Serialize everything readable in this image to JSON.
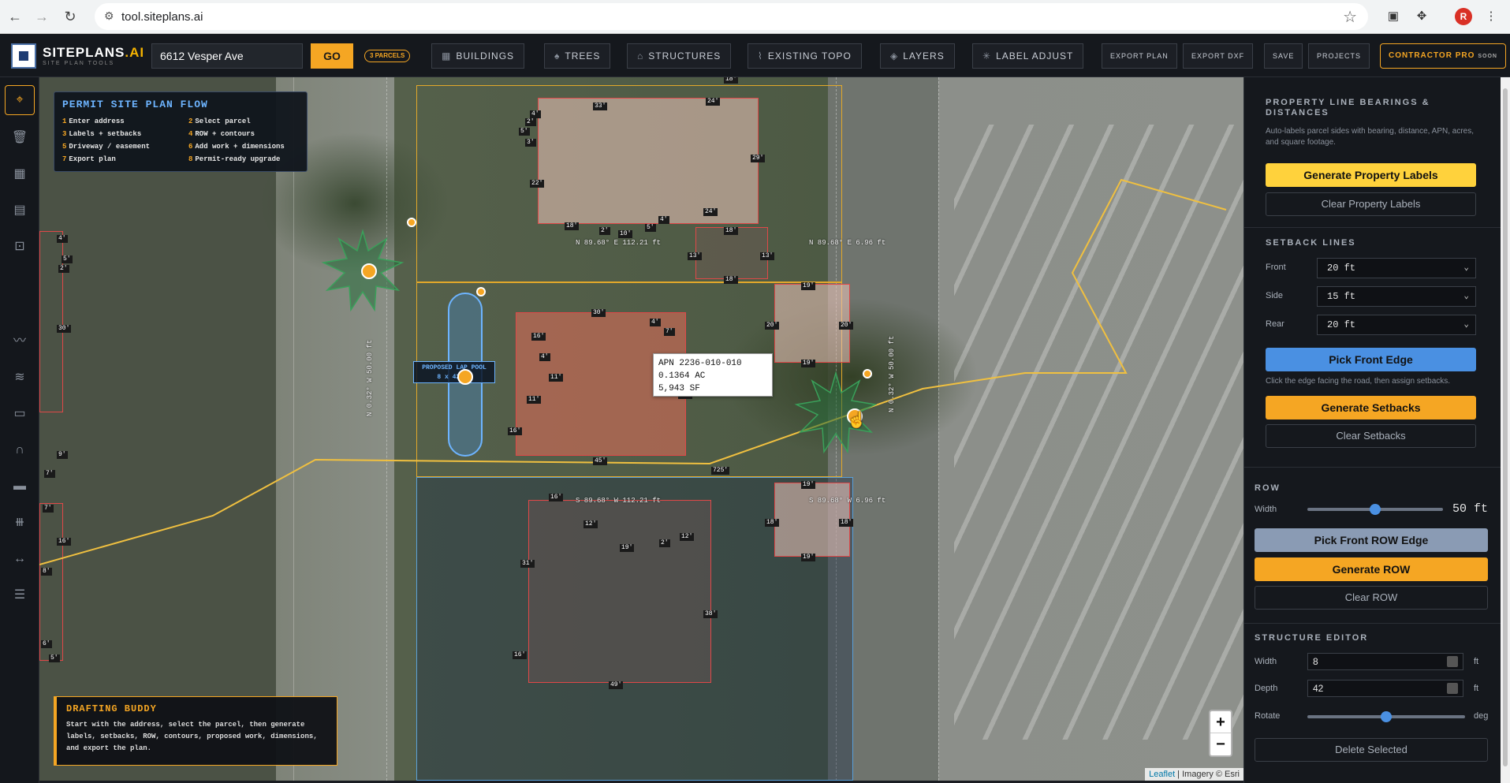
{
  "browser": {
    "url": "tool.siteplans.ai",
    "avatar_letter": "R"
  },
  "topbar": {
    "brand": "SITEPLANS",
    "brand_suffix": ".AI",
    "tagline": "SITE PLAN TOOLS",
    "address_value": "6612 Vesper Ave",
    "go_label": "GO",
    "parcels_badge": "3 PARCELS",
    "buttons": {
      "buildings": "BUILDINGS",
      "trees": "TREES",
      "structures": "STRUCTURES",
      "existing_topo": "EXISTING TOPO",
      "layers": "LAYERS",
      "label_adjust": "LABEL ADJUST",
      "export_plan": "EXPORT PLAN",
      "export_dxf": "EXPORT DXF",
      "save": "SAVE",
      "projects": "PROJECTS"
    },
    "pro_label": "CONTRACTOR PRO",
    "pro_soon": "SOON"
  },
  "map": {
    "flow": {
      "title": "PERMIT SITE PLAN FLOW",
      "steps": [
        {
          "n": "1",
          "text": "Enter address"
        },
        {
          "n": "2",
          "text": "Select parcel"
        },
        {
          "n": "3",
          "text": "Labels + setbacks"
        },
        {
          "n": "4",
          "text": "ROW + contours"
        },
        {
          "n": "5",
          "text": "Driveway / easement"
        },
        {
          "n": "6",
          "text": "Add work + dimensions"
        },
        {
          "n": "7",
          "text": "Export plan"
        },
        {
          "n": "8",
          "text": "Permit-ready upgrade"
        }
      ]
    },
    "apn": {
      "line1": "APN 2236-010-010",
      "line2": "0.1364 AC",
      "line3": "5,943 SF"
    },
    "pool": {
      "line1": "PROPOSED LAP POOL",
      "line2": "8 x 42 ft"
    },
    "bearings": {
      "b1": "N 89.68° E 112.21 ft",
      "b2": "N 89.68° E 6.96 ft",
      "b3": "S 89.68° W 112.21 ft",
      "b4": "S 89.68° W 6.96 ft",
      "b5": "N 0.32° W 50.00 ft",
      "b6": "N 0.32° W 50.00 ft"
    },
    "dims": {
      "d18a": "18'",
      "d33": "33'",
      "d24a": "24'",
      "d4a": "4'",
      "d2a": "2'",
      "d5a": "5'",
      "d3a": "3'",
      "d22": "22'",
      "d29": "29'",
      "d24b": "24'",
      "d18b": "18'",
      "d2b": "2'",
      "d10": "10'",
      "d5b": "5'",
      "d4b": "4'",
      "d18c": "18'",
      "d13a": "13'",
      "d13b": "13'",
      "d18d": "18'",
      "d19a": "19'",
      "d20a": "20'",
      "d20b": "20'",
      "d19b": "19'",
      "d30": "30'",
      "d4c": "4'",
      "d7a": "7'",
      "d16a": "16'",
      "d4d": "4'",
      "d11a": "11'",
      "d11b": "11'",
      "d16b": "16'",
      "d45": "45'",
      "d33b": "33'",
      "d725": "725'",
      "d19c": "19'",
      "d18e": "18'",
      "d18f": "18'",
      "d19d": "19'",
      "d16c": "16'",
      "d12a": "12'",
      "d19e": "19'",
      "d2c": "2'",
      "d12b": "12'",
      "d31": "31'",
      "d38": "38'",
      "d16d": "16'",
      "d49": "49'",
      "l4": "4'",
      "l5": "5'",
      "l2": "2'",
      "l30": "30'",
      "l9": "9'",
      "l7a": "7'",
      "l7b": "7'",
      "l16": "16'",
      "l8": "8'",
      "l6": "6'",
      "l5b": "5'"
    },
    "buddy": {
      "title": "DRAFTING BUDDY",
      "text": "Start with the address, select the parcel, then generate labels, setbacks, ROW, contours, proposed work, dimensions, and export the plan."
    },
    "zoom_in": "+",
    "zoom_out": "−",
    "attribution_leaflet": "Leaflet",
    "attribution_rest": " | Imagery © Esri"
  },
  "panel": {
    "property": {
      "heading": "PROPERTY LINE BEARINGS & DISTANCES",
      "note": "Auto-labels parcel sides with bearing, distance, APN, acres, and square footage.",
      "generate": "Generate Property Labels",
      "clear": "Clear Property Labels"
    },
    "setback": {
      "heading": "SETBACK LINES",
      "front_label": "Front",
      "front_value": "20 ft",
      "side_label": "Side",
      "side_value": "15 ft",
      "rear_label": "Rear",
      "rear_value": "20 ft",
      "pick": "Pick Front Edge",
      "note": "Click the edge facing the road, then assign setbacks.",
      "generate": "Generate Setbacks",
      "clear": "Clear Setbacks"
    },
    "row": {
      "heading": "ROW",
      "width_label": "Width",
      "width_value": "50 ft",
      "width_fraction": 0.5,
      "pick": "Pick Front ROW Edge",
      "generate": "Generate ROW",
      "clear": "Clear ROW"
    },
    "structure": {
      "heading": "STRUCTURE EDITOR",
      "width_label": "Width",
      "width_value": "8",
      "width_unit": "ft",
      "depth_label": "Depth",
      "depth_value": "42",
      "depth_unit": "ft",
      "rotate_label": "Rotate",
      "rotate_unit": "deg",
      "rotate_fraction": 0.5,
      "delete": "Delete Selected"
    }
  },
  "colors": {
    "accent": "#f5a623",
    "parcel_line": "#e3a92a",
    "building_line": "#e04848",
    "pick_blue": "#4a90e2"
  }
}
